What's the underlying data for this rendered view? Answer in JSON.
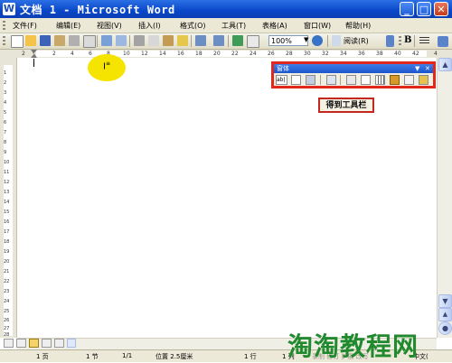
{
  "window": {
    "title": "文档 1 - Microsoft Word",
    "minimize": "_",
    "maximize": "□",
    "close": "✕",
    "app_icon": "W"
  },
  "menu": {
    "items": [
      "文件(F)",
      "编辑(E)",
      "视图(V)",
      "插入(I)",
      "格式(O)",
      "工具(T)",
      "表格(A)",
      "窗口(W)",
      "帮助(H)"
    ]
  },
  "toolbar": {
    "zoom": "100%",
    "read_label": "阅读(R)",
    "bold": "B"
  },
  "ruler": {
    "ticks": [
      "2",
      "2",
      "4",
      "6",
      "8",
      "10",
      "12",
      "14",
      "16",
      "18",
      "20",
      "22",
      "24",
      "26",
      "28",
      "30",
      "32",
      "34",
      "36",
      "38",
      "40",
      "42",
      "4"
    ]
  },
  "vertical_ruler": {
    "ticks": [
      "1",
      "2",
      "3",
      "4",
      "5",
      "6",
      "7",
      "8",
      "9",
      "10",
      "11",
      "12",
      "13",
      "14",
      "15",
      "16",
      "17",
      "18",
      "19",
      "20",
      "21",
      "22",
      "23",
      "24",
      "25",
      "26",
      "27",
      "28"
    ]
  },
  "floating_toolbar": {
    "title": "窗体",
    "caption": "得到工具栏",
    "icons": [
      "text-field-icon",
      "checkbox-icon",
      "dropdown-icon",
      "separator",
      "dropdown-field-icon",
      "frame-icon",
      "table-icon",
      "table-insert-icon",
      "shading-icon",
      "reset-icon",
      "lock-icon"
    ]
  },
  "statusbar": {
    "page": "1 页",
    "section": "1 节",
    "pages": "1/1",
    "position": "位置 2.5厘米",
    "line": "1 行",
    "col": "1 列",
    "lang": "中文(",
    "extra": "录制 修订 扩展 改写"
  },
  "watermark": "淘淘教程网",
  "colors": {
    "titlebar": "#0a47c9",
    "highlight": "#f5e400",
    "callout_border": "#e2271d",
    "watermark": "#228a2e"
  }
}
